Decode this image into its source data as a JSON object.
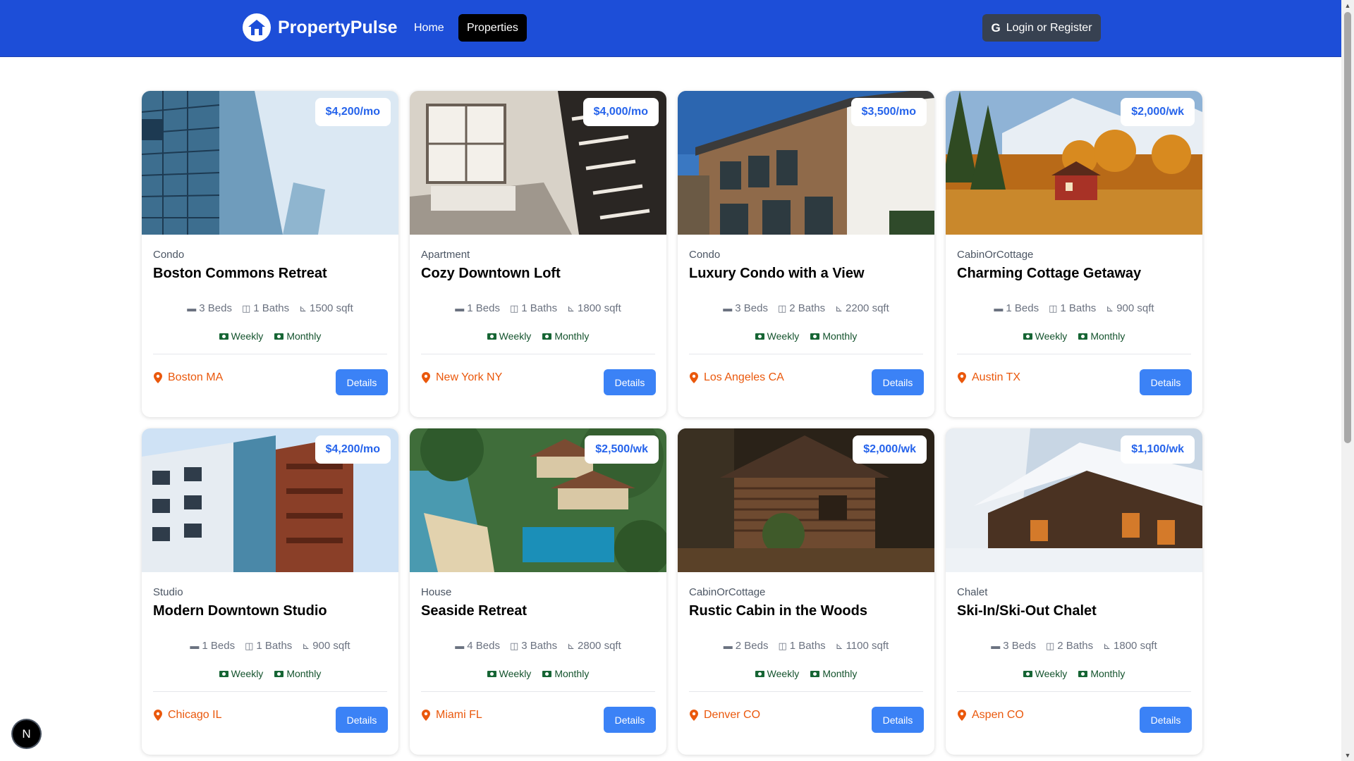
{
  "nav": {
    "brand": "PropertyPulse",
    "links": [
      {
        "label": "Home",
        "active": false
      },
      {
        "label": "Properties",
        "active": true
      }
    ],
    "login_label": "Login or Register",
    "login_icon": "google-icon"
  },
  "colors": {
    "navbar": "#1d4ed8",
    "active_link": "#000000",
    "login_button": "#374151",
    "badge_text": "#2563eb",
    "details_button": "#3b82f6",
    "location_text": "#ea580c",
    "rate_text": "#14532d"
  },
  "rate_options": [
    "Weekly",
    "Monthly"
  ],
  "details_label": "Details",
  "properties": [
    {
      "type": "Condo",
      "name": "Boston Commons Retreat",
      "rate": "$4,200/mo",
      "beds": "3 Beds",
      "baths": "1 Baths",
      "sqft": "1500 sqft",
      "location": "Boston MA",
      "image": "glass-tower"
    },
    {
      "type": "Apartment",
      "name": "Cozy Downtown Loft",
      "rate": "$4,000/mo",
      "beds": "1 Beds",
      "baths": "1 Baths",
      "sqft": "1800 sqft",
      "location": "New York NY",
      "image": "loft-interior"
    },
    {
      "type": "Condo",
      "name": "Luxury Condo with a View",
      "rate": "$3,500/mo",
      "beds": "3 Beds",
      "baths": "2 Baths",
      "sqft": "2200 sqft",
      "location": "Los Angeles CA",
      "image": "modern-house"
    },
    {
      "type": "CabinOrCottage",
      "name": "Charming Cottage Getaway",
      "rate": "$2,000/wk",
      "beds": "1 Beds",
      "baths": "1 Baths",
      "sqft": "900 sqft",
      "location": "Austin TX",
      "image": "autumn-cottage"
    },
    {
      "type": "Studio",
      "name": "Modern Downtown Studio",
      "rate": "$4,200/mo",
      "beds": "1 Beds",
      "baths": "1 Baths",
      "sqft": "900 sqft",
      "location": "Chicago IL",
      "image": "brick-apartments"
    },
    {
      "type": "House",
      "name": "Seaside Retreat",
      "rate": "$2,500/wk",
      "beds": "4 Beds",
      "baths": "3 Baths",
      "sqft": "2800 sqft",
      "location": "Miami FL",
      "image": "tropical-villa"
    },
    {
      "type": "CabinOrCottage",
      "name": "Rustic Cabin in the Woods",
      "rate": "$2,000/wk",
      "beds": "2 Beds",
      "baths": "1 Baths",
      "sqft": "1100 sqft",
      "location": "Denver CO",
      "image": "log-cabin"
    },
    {
      "type": "Chalet",
      "name": "Ski-In/Ski-Out Chalet",
      "rate": "$1,100/wk",
      "beds": "3 Beds",
      "baths": "2 Baths",
      "sqft": "1800 sqft",
      "location": "Aspen CO",
      "image": "snowy-chalet"
    }
  ],
  "dev_indicator": "N"
}
